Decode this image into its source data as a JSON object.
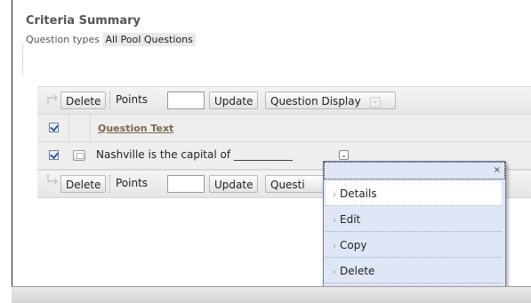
{
  "criteria": {
    "title": "Criteria Summary",
    "question_types_label": "Question types",
    "question_types_value": "All Pool Questions"
  },
  "toolbar_top": {
    "delete_label": "Delete",
    "points_label": "Points",
    "points_value": "",
    "update_label": "Update",
    "question_display_label": "Question Display"
  },
  "table": {
    "column_header": "Question Text",
    "rows": [
      {
        "text": "Nashville is the capital of ___________"
      }
    ]
  },
  "toolbar_bottom": {
    "delete_label": "Delete",
    "points_label": "Points",
    "points_value": "",
    "update_label": "Update",
    "question_display_label": "Questi"
  },
  "context_menu": {
    "close_label": "×",
    "items": [
      "Details",
      "Edit",
      "Copy",
      "Delete"
    ]
  },
  "icons": {
    "caret": "›",
    "select_arrow": "⌄"
  }
}
